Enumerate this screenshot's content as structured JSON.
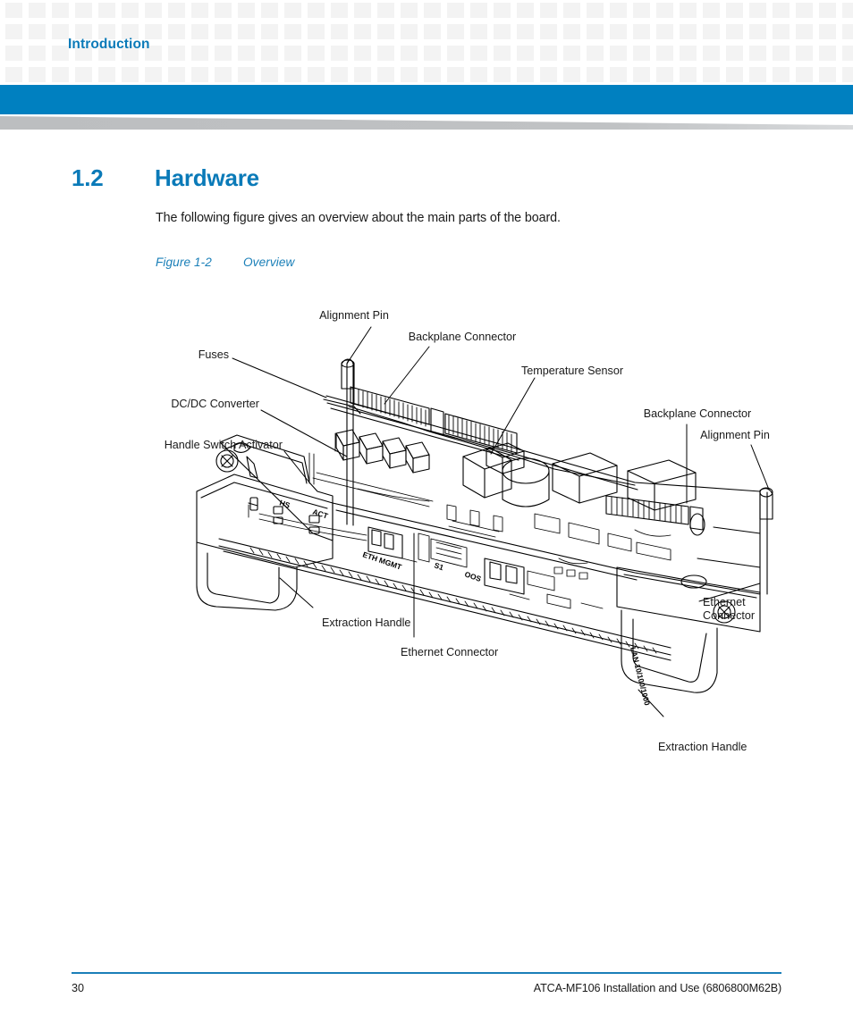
{
  "header": {
    "chapter_title": "Introduction",
    "accent_color": "#0080c0",
    "title_color": "#0a7ab8",
    "grid_cell_color": "#f3f3f3",
    "wedge_color": "#bcbec0"
  },
  "section": {
    "number": "1.2",
    "title": "Hardware",
    "body_text": "The following figure gives an overview about the main parts of the board."
  },
  "figure": {
    "label": "Figure 1-2",
    "caption": "Overview",
    "caption_color": "#1a7fb8",
    "callouts": [
      {
        "id": "alignment-pin-top",
        "text": "Alignment Pin"
      },
      {
        "id": "backplane-connector-top",
        "text": "Backplane Connector"
      },
      {
        "id": "temperature-sensor",
        "text": "Temperature Sensor"
      },
      {
        "id": "backplane-connector-right",
        "text": "Backplane Connector"
      },
      {
        "id": "alignment-pin-right",
        "text": "Alignment Pin"
      },
      {
        "id": "fuses",
        "text": "Fuses"
      },
      {
        "id": "dcdc-converter",
        "text": "DC/DC Converter"
      },
      {
        "id": "handle-switch-activator",
        "text": "Handle Switch Activator"
      },
      {
        "id": "extraction-handle-left",
        "text": "Extraction Handle"
      },
      {
        "id": "ethernet-connector-center",
        "text": "Ethernet Connector"
      },
      {
        "id": "ethernet-connector-right-line1",
        "text": "Ethernet"
      },
      {
        "id": "ethernet-connector-right-line2",
        "text": "Connector"
      },
      {
        "id": "extraction-handle-right",
        "text": "Extraction Handle"
      }
    ],
    "faceplate_markings": [
      "HS",
      "ACT",
      "ETH MGMT",
      "S1",
      "OOS",
      "LAN 10/100/1000"
    ]
  },
  "footer": {
    "page_number": "30",
    "document_title": "ATCA-MF106 Installation and Use (6806800M62B)",
    "rule_color": "#1a7fb8"
  }
}
